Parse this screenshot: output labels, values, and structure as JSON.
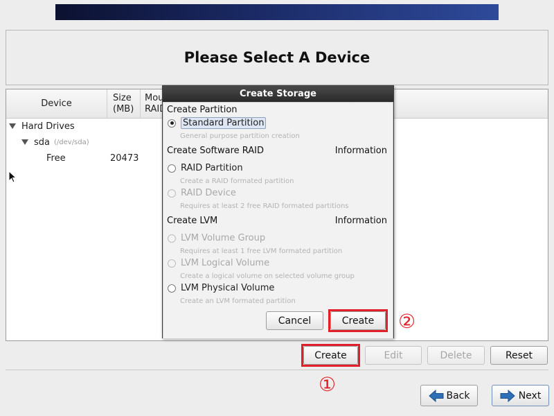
{
  "header": {
    "title": "Please Select A Device"
  },
  "tree": {
    "columns": {
      "device": "Device",
      "size_line1": "Size",
      "size_line2": "(MB)",
      "mount_line1": "Mou",
      "mount_line2": "RAID"
    },
    "rows": [
      {
        "label": "Hard Drives"
      },
      {
        "label": "sda",
        "path": "(/dev/sda)"
      },
      {
        "label": "Free",
        "size": "20473"
      }
    ]
  },
  "dialog": {
    "title": "Create Storage",
    "sections": {
      "partition": "Create Partition",
      "raid": "Create Software RAID",
      "raid_info": "Information",
      "lvm": "Create LVM",
      "lvm_info": "Information"
    },
    "options": [
      {
        "label": "Standard Partition",
        "desc": "General purpose partition creation",
        "selected": true
      },
      {
        "label": "RAID Partition",
        "desc": "Create a RAID formated partition"
      },
      {
        "label": "RAID Device",
        "desc": "Requires at least 2 free RAID formated partitions"
      },
      {
        "label": "LVM Volume Group",
        "desc": "Requires at least 1 free LVM formated partition"
      },
      {
        "label": "LVM Logical Volume",
        "desc": "Create a logical volume on selected volume group"
      },
      {
        "label": "LVM Physical Volume",
        "desc": "Create an LVM formated partition"
      }
    ],
    "cancel_label": "Cancel",
    "create_label": "Create"
  },
  "toolbar": {
    "create": "Create",
    "edit": "Edit",
    "delete": "Delete",
    "reset": "Reset"
  },
  "nav": {
    "back": "Back",
    "next": "Next"
  },
  "annotations": {
    "marker_1": "①",
    "marker_2": "②"
  },
  "colors": {
    "highlight": "#e2202a",
    "nav_arrow": "#2f6fb6"
  }
}
